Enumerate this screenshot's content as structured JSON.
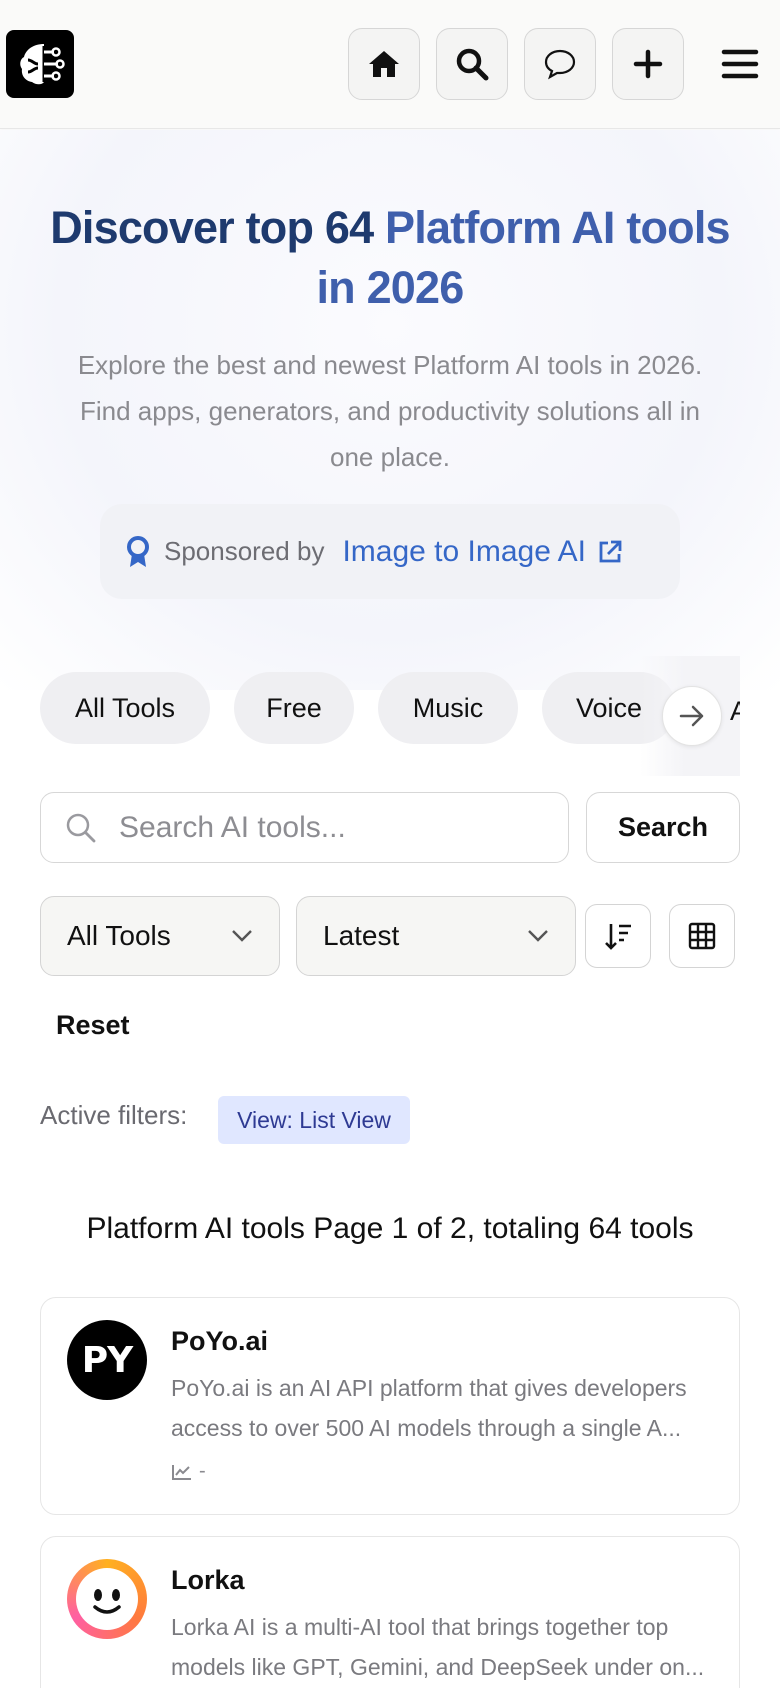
{
  "header": {
    "logo_icon": "brain-circuit-icon",
    "buttons": [
      {
        "name": "home-button",
        "icon": "home-icon"
      },
      {
        "name": "search-button",
        "icon": "search-icon"
      },
      {
        "name": "chat-button",
        "icon": "chat-bubble-icon"
      },
      {
        "name": "add-button",
        "icon": "plus-icon"
      }
    ],
    "menu_icon": "hamburger-menu-icon"
  },
  "hero": {
    "title_prefix": "Discover top 64 ",
    "title_accent": "Platform AI tools",
    "title_suffix": "in 2026",
    "subtitle_lines": [
      "Explore the best and newest Platform AI tools in 2026.",
      "Find apps, generators, and productivity solutions all in",
      "one place."
    ]
  },
  "sponsor": {
    "label": "Sponsored by",
    "link_text": "Image to Image AI",
    "icon": "award-ribbon-icon",
    "link_icon": "external-link-icon"
  },
  "categories": {
    "chips": [
      "All Tools",
      "Free",
      "Music",
      "Voice"
    ],
    "peek": "A",
    "next_icon": "arrow-right-icon"
  },
  "search": {
    "placeholder": "Search AI tools...",
    "button_label": "Search"
  },
  "filters": {
    "type_select": "All Tools",
    "sort_select": "Latest",
    "sort_order_icon": "sort-descending-icon",
    "view_icon": "grid-view-icon",
    "reset_label": "Reset",
    "active_label": "Active filters:",
    "active_tags": [
      "View: List View"
    ]
  },
  "results": {
    "summary": "Platform AI tools Page 1 of 2, totaling 64 tools",
    "tools": [
      {
        "name": "PoYo.ai",
        "avatar_text": "PY",
        "desc_lines": [
          "PoYo.ai is an AI API platform that gives developers",
          "access to over 500 AI models through a single A..."
        ],
        "stat": "-"
      },
      {
        "name": "Lorka",
        "desc_lines": [
          "Lorka AI is a multi-AI tool that brings together top",
          "models like GPT, Gemini, and DeepSeek under on..."
        ]
      }
    ]
  },
  "colors": {
    "title": "#1e3a6e",
    "accent": "#3f5fac",
    "link": "#3567c7",
    "tag_bg": "#e0e7ff",
    "tag_text": "#2e3a93"
  }
}
